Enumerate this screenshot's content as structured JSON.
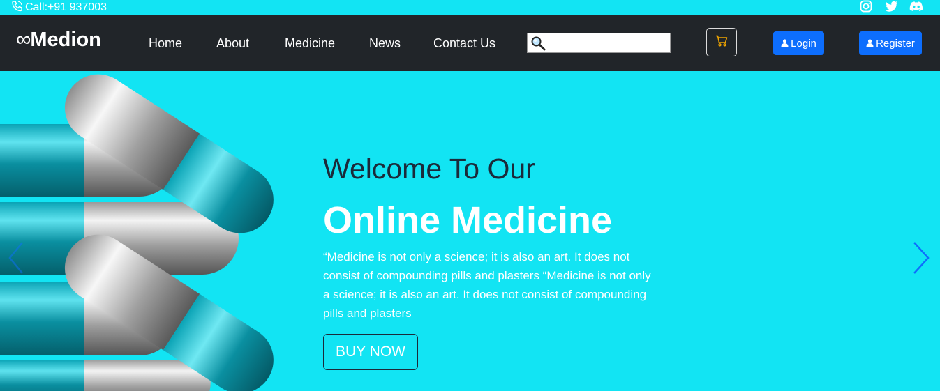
{
  "topbar": {
    "call_text": "Call:+91 937003",
    "social_icons": [
      "instagram-icon",
      "twitter-icon",
      "discord-icon"
    ]
  },
  "navbar": {
    "brand_symbol": "∞",
    "brand_name": "Medion",
    "links": [
      "Home",
      "About",
      "Medicine",
      "News",
      "Contact Us"
    ],
    "search": {
      "value": "",
      "placeholder": ""
    },
    "cart_icon": "cart-icon",
    "login_label": "Login",
    "register_label": "Register"
  },
  "hero": {
    "pre_title": "Welcome To Our",
    "title": "Online Medicine",
    "description": "“Medicine is not only a science; it is also an art. It does not consist of compounding pills and plasters “Medicine is not only a science; it is also an art. It does not consist of compounding pills and plasters",
    "cta_label": "BUY NOW"
  },
  "colors": {
    "hero_bg": "#12e4f3",
    "navbar_bg": "#212529",
    "button_primary": "#0d6efd",
    "cart_accent": "#f0a500",
    "arrow": "#0d6efd"
  }
}
